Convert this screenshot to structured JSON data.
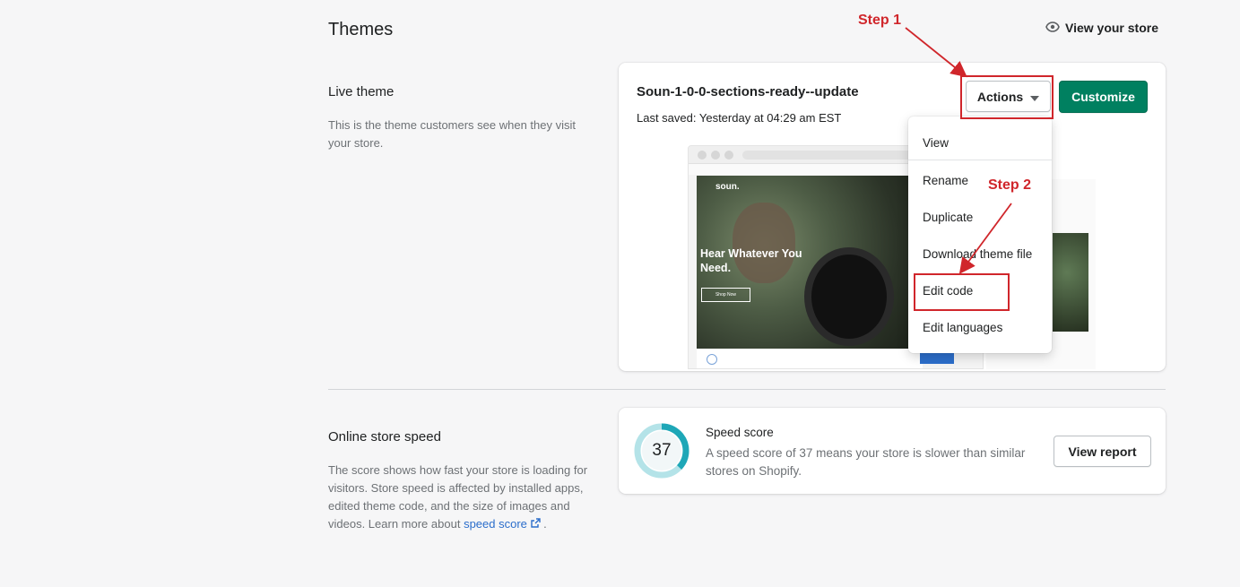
{
  "header": {
    "title": "Themes",
    "view_store": "View your store"
  },
  "live_theme": {
    "section_title": "Live theme",
    "section_desc": "This is the theme customers see when they visit your store.",
    "name": "Soun-1-0-0-sections-ready--update",
    "last_saved": "Last saved: Yesterday at 04:29 am EST",
    "actions_label": "Actions",
    "customize_label": "Customize",
    "preview": {
      "logo": "soun.",
      "hero_text": "Hear Whatever You Need.",
      "shop_button": "Shop Now"
    }
  },
  "actions_menu": {
    "items": [
      "View",
      "Rename",
      "Duplicate",
      "Download theme file",
      "Edit code",
      "Edit languages"
    ]
  },
  "annotations": {
    "step1": "Step 1",
    "step2": "Step 2",
    "color": "#d0262b"
  },
  "speed": {
    "section_title": "Online store speed",
    "section_desc": "The score shows how fast your store is loading for visitors. Store speed is affected by installed apps, edited theme code, and the size of images and videos. Learn more about",
    "link_text": "speed score",
    "link_suffix": ".",
    "score": "37",
    "score_value": 0.37,
    "card_title": "Speed score",
    "card_desc": "A speed score of 37 means your store is slower than similar stores on Shopify.",
    "view_report": "View report"
  },
  "colors": {
    "primary": "#008060",
    "gauge": "#1ea7b7",
    "link": "#2c6ecb"
  }
}
